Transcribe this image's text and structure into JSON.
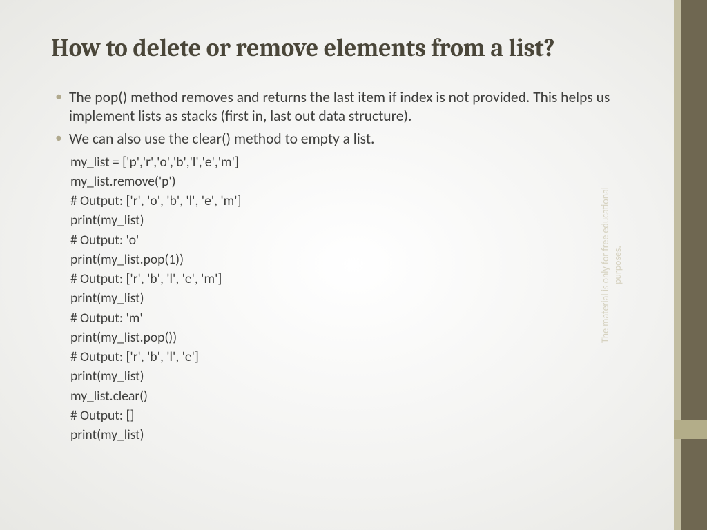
{
  "title": "How to delete or remove elements from a list?",
  "bullets": [
    "The pop() method removes and returns the last item if index is not provided. This helps us implement lists as stacks (first in, last out data structure).",
    "We can also use the clear() method to empty a list."
  ],
  "code": [
    "my_list = ['p','r','o','b','l','e','m']",
    "my_list.remove('p')",
    "# Output: ['r', 'o', 'b', 'l', 'e', 'm']",
    "print(my_list)",
    "# Output: 'o'",
    "print(my_list.pop(1))",
    "# Output: ['r', 'b', 'l', 'e', 'm']",
    "print(my_list)",
    "# Output: 'm'",
    "print(my_list.pop())",
    "# Output: ['r', 'b', 'l', 'e']",
    "print(my_list)",
    "my_list.clear()",
    "# Output: []",
    "print(my_list)"
  ],
  "sidebar_note": "The material is only for free educational purposes."
}
